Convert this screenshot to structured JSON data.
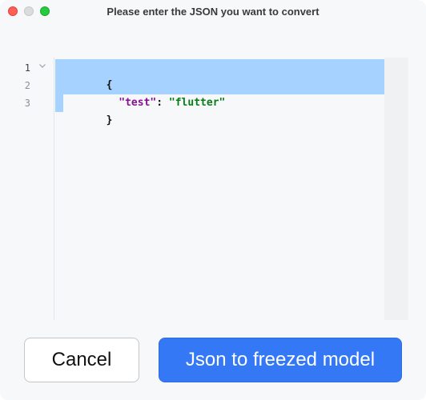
{
  "window": {
    "title": "Please enter the JSON you want to convert"
  },
  "editor": {
    "line_numbers": [
      "1",
      "2",
      "3"
    ],
    "lines": {
      "l1_brace": "{",
      "l2_key": "\"test\"",
      "l2_colon": ": ",
      "l2_value": "\"flutter\"",
      "l3_brace": "}"
    },
    "selection_color": "#a6d2ff",
    "key_color": "#871094",
    "string_color": "#067d17"
  },
  "buttons": {
    "cancel_label": "Cancel",
    "convert_label": "Json to freezed model",
    "primary_color": "#3478f6"
  },
  "icons": {
    "fold": "chevron-down-icon"
  }
}
